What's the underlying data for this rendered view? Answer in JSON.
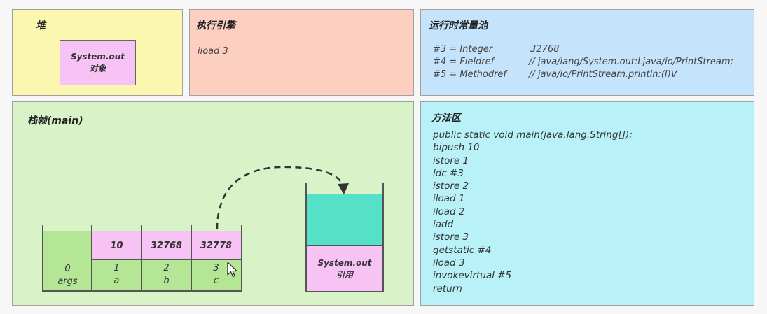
{
  "heap": {
    "title": "堆",
    "object_line1": "System.out",
    "object_line2": "对象"
  },
  "engine": {
    "title": "执行引擎",
    "instruction": "iload 3"
  },
  "pool": {
    "title": "运行时常量池",
    "entries": [
      {
        "ref": "#3 = Integer",
        "value": "32768"
      },
      {
        "ref": "#4 = Fieldref",
        "value": "// java/lang/System.out:Ljava/io/PrintStream;"
      },
      {
        "ref": "#5 = Methodref",
        "value": "// java/io/PrintStream.println:(I)V"
      }
    ]
  },
  "frame": {
    "title": "栈帧(main)",
    "locals": [
      {
        "value": "",
        "index": "0",
        "name": "args"
      },
      {
        "value": "10",
        "index": "1",
        "name": "a"
      },
      {
        "value": "32768",
        "index": "2",
        "name": "b"
      },
      {
        "value": "32778",
        "index": "3",
        "name": "c"
      }
    ],
    "stack_ref_line1": "System.out",
    "stack_ref_line2": "引用"
  },
  "method": {
    "title": "方法区",
    "code": [
      "public static void main(java.lang.String[]);",
      "bipush 10",
      "istore 1",
      "ldc #3",
      "istore 2",
      "iload 1",
      "iload 2",
      "iadd",
      "istore 3",
      "getstatic #4",
      "iload 3",
      "invokevirtual #5",
      "return"
    ]
  }
}
